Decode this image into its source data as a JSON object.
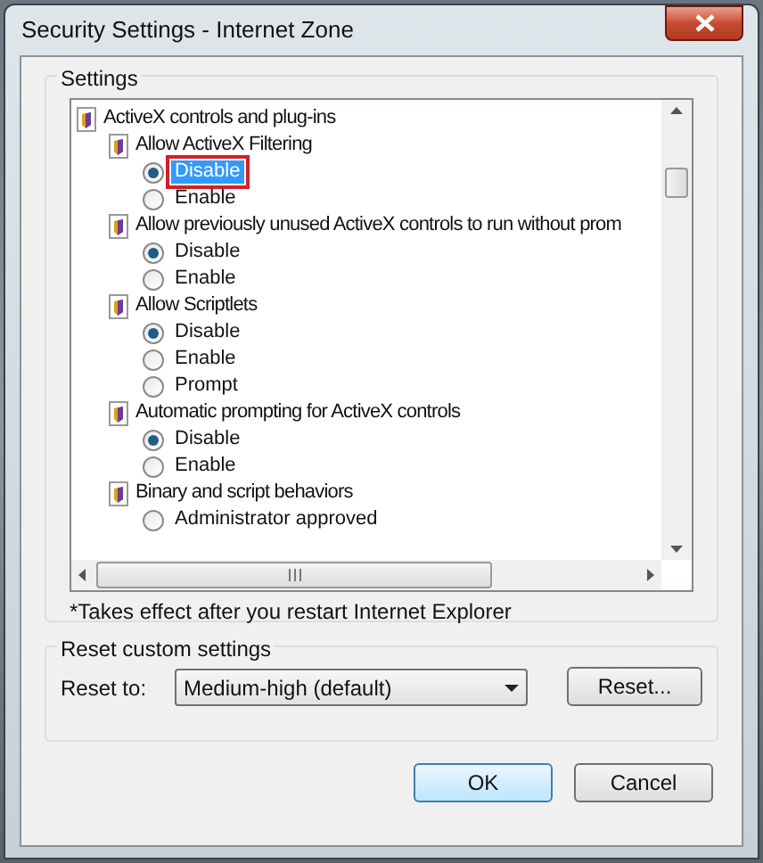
{
  "window": {
    "title": "Security Settings - Internet Zone"
  },
  "settings_group": {
    "title": "Settings",
    "tree": [
      {
        "label": "ActiveX controls and plug-ins",
        "children": [
          {
            "label": "Allow ActiveX Filtering",
            "children": [
              {
                "label": "Disable",
                "selected": true,
                "focused": true
              },
              {
                "label": "Enable",
                "selected": false,
                "focused": false
              }
            ]
          },
          {
            "label": "Allow previously unused ActiveX controls to run without prom",
            "children": [
              {
                "label": "Disable",
                "selected": true,
                "focused": false
              },
              {
                "label": "Enable",
                "selected": false,
                "focused": false
              }
            ]
          },
          {
            "label": "Allow Scriptlets",
            "children": [
              {
                "label": "Disable",
                "selected": true,
                "focused": false
              },
              {
                "label": "Enable",
                "selected": false,
                "focused": false
              },
              {
                "label": "Prompt",
                "selected": false,
                "focused": false
              }
            ]
          },
          {
            "label": "Automatic prompting for ActiveX controls",
            "children": [
              {
                "label": "Disable",
                "selected": true,
                "focused": false
              },
              {
                "label": "Enable",
                "selected": false,
                "focused": false
              }
            ]
          },
          {
            "label": "Binary and script behaviors",
            "children": [
              {
                "label": "Administrator approved",
                "selected": false,
                "focused": false
              }
            ]
          }
        ]
      }
    ],
    "note": "*Takes effect after you restart Internet Explorer"
  },
  "reset_group": {
    "title": "Reset custom settings",
    "label": "Reset to:",
    "value": "Medium-high (default)",
    "button": "Reset..."
  },
  "buttons": [
    "OK",
    "Cancel"
  ]
}
